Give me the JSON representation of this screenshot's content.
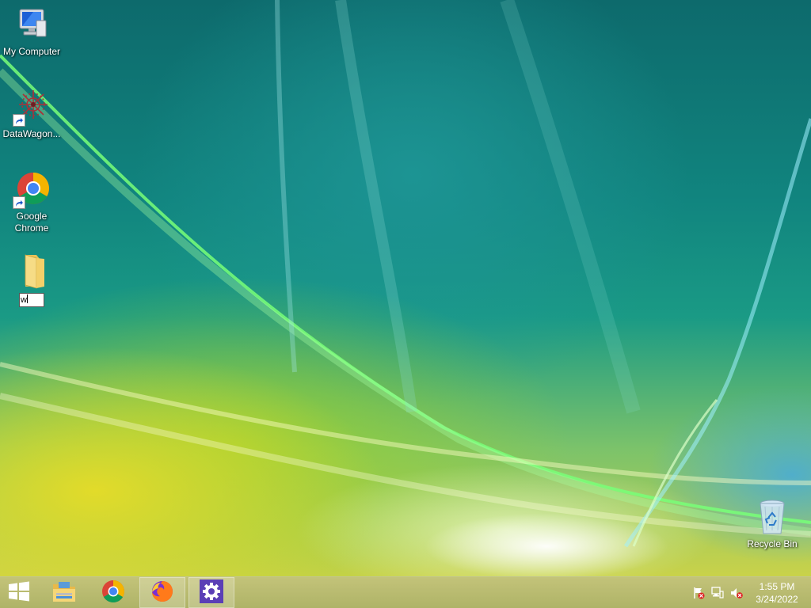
{
  "desktop": {
    "icons": [
      {
        "label": "My Computer",
        "icon": "my-computer-icon"
      },
      {
        "label": "DataWagon...",
        "icon": "datawagon-icon",
        "shortcut": true
      },
      {
        "label": "Google Chrome",
        "icon": "chrome-icon",
        "shortcut": true
      },
      {
        "label": "",
        "icon": "folder-icon",
        "rename_value": "w"
      },
      {
        "label": "Recycle Bin",
        "icon": "recycle-bin-icon"
      }
    ]
  },
  "taskbar": {
    "buttons": [
      {
        "icon": "windows-start-icon"
      },
      {
        "icon": "file-explorer-icon"
      },
      {
        "icon": "chrome-icon"
      },
      {
        "icon": "firefox-icon",
        "active": true
      },
      {
        "icon": "settings-gear-icon",
        "active": true
      }
    ],
    "tray": [
      {
        "icon": "action-center-flag-icon"
      },
      {
        "icon": "network-icon"
      },
      {
        "icon": "volume-muted-icon"
      }
    ],
    "clock": {
      "time": "1:55 PM",
      "date": "3/24/2022"
    }
  },
  "colors": {
    "taskbar": "#b4b46e",
    "settings_tile": "#5b3fb6",
    "wallpaper_teal": "#11857f",
    "wallpaper_yellow": "#c9d24a"
  }
}
